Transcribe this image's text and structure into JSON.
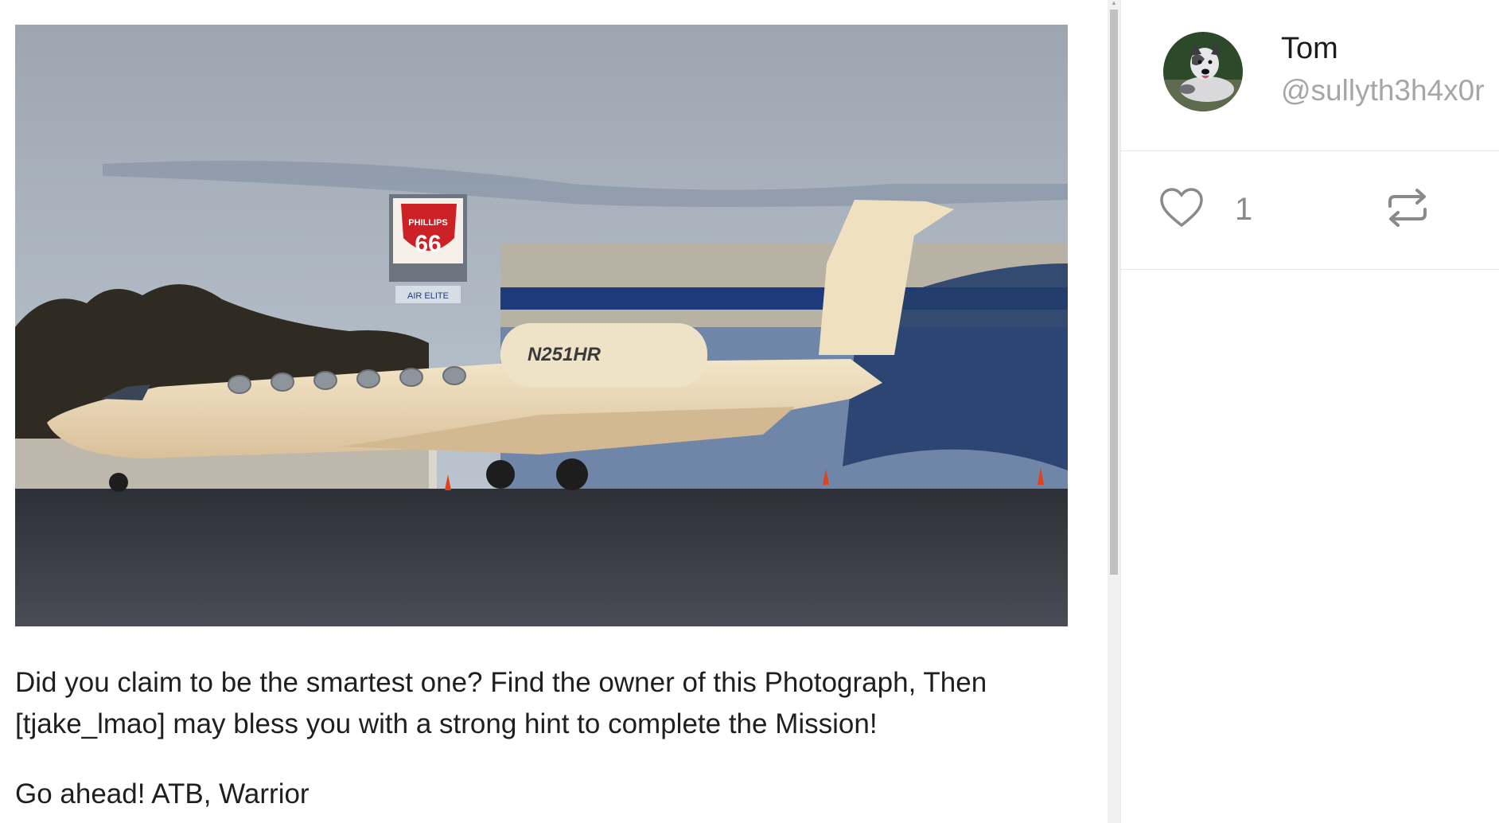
{
  "post": {
    "image_alt": "Gulfstream jet N251HR parked on apron",
    "photo_texts": {
      "sign_brand": "PHILLIPS",
      "sign_number": "66",
      "sign_sub": "AIR ELITE",
      "tail_number": "N251HR"
    },
    "paragraphs": [
      "Did you claim to be the smartest one? Find the owner of this Photograph, Then [tjake_lmao] may bless you with a strong hint to complete the Mission!",
      "Go ahead! ATB, Warrior"
    ]
  },
  "author": {
    "name": "Tom",
    "handle": "@sullyth3h4x0r",
    "avatar_icon": "dog-avatar"
  },
  "actions": {
    "like_icon": "heart-icon",
    "like_count": "1",
    "repost_icon": "repost-icon"
  },
  "colors": {
    "text": "#1f1f1f",
    "muted": "#a6a6a6",
    "divider": "#e6e6e6",
    "icon": "#8a8a8a"
  }
}
